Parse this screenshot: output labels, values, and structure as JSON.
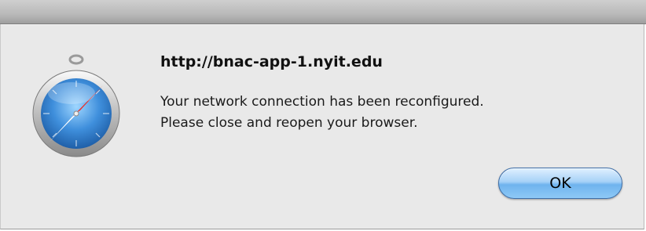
{
  "dialog": {
    "title": "http://bnac-app-1.nyit.edu",
    "message_lines": [
      "Your network connection has been reconfigured.",
      "Please close and reopen your browser."
    ],
    "ok_label": "OK",
    "icon": "safari-compass-icon"
  },
  "colors": {
    "dialog_bg": "#e9e9e9",
    "button_accent": "#6fb3ee"
  }
}
